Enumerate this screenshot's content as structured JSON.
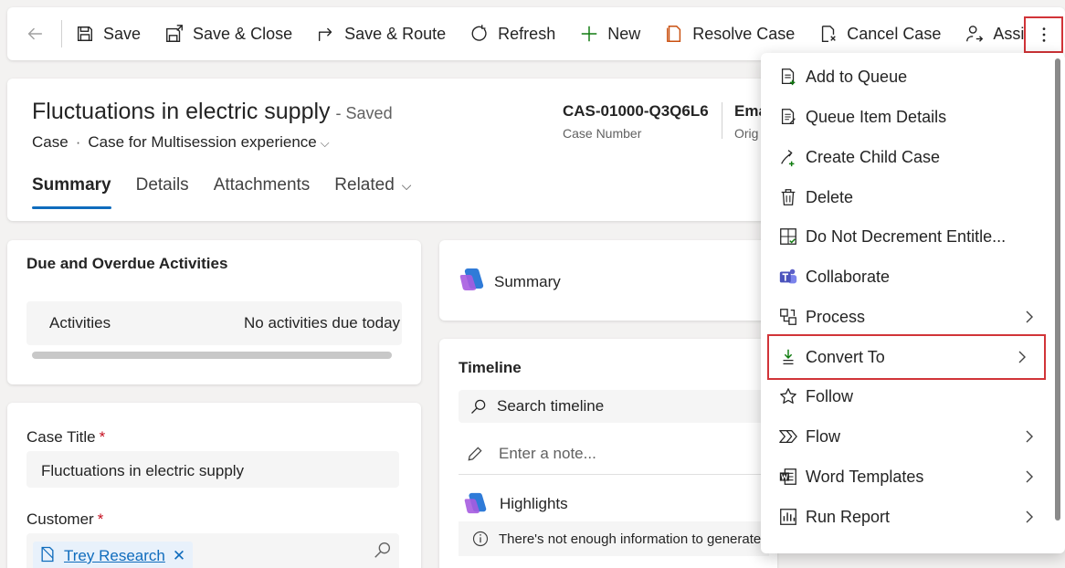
{
  "toolbar": {
    "save": "Save",
    "save_close": "Save & Close",
    "save_route": "Save & Route",
    "refresh": "Refresh",
    "new": "New",
    "resolve_case": "Resolve Case",
    "cancel_case": "Cancel Case",
    "assign": "Assign"
  },
  "record": {
    "title": "Fluctuations in electric supply",
    "status": "- Saved",
    "entity": "Case",
    "form": "Case for Multisession experience",
    "case_number": "CAS-01000-Q3Q6L6",
    "case_number_label": "Case Number",
    "origin_value": "Ema",
    "origin_label": "Orig"
  },
  "tabs": [
    "Summary",
    "Details",
    "Attachments",
    "Related"
  ],
  "due_card": {
    "title": "Due and Overdue Activities",
    "row_label": "Activities",
    "row_value": "No activities due today"
  },
  "form": {
    "case_title_label": "Case Title",
    "case_title_value": "Fluctuations in electric supply",
    "customer_label": "Customer",
    "customer_value": "Trey Research",
    "required_mark": "*"
  },
  "summary_card": {
    "label": "Summary"
  },
  "timeline": {
    "title": "Timeline",
    "search_placeholder": "Search timeline",
    "note_placeholder": "Enter a note...",
    "highlights": "Highlights",
    "info": "There's not enough information to generate"
  },
  "menu": {
    "items": [
      {
        "label": "Add to Queue",
        "icon": "add-to-queue-icon"
      },
      {
        "label": "Queue Item Details",
        "icon": "queue-details-icon"
      },
      {
        "label": "Create Child Case",
        "icon": "child-case-icon"
      },
      {
        "label": "Delete",
        "icon": "trash-icon"
      },
      {
        "label": "Do Not Decrement Entitle...",
        "icon": "entitlement-icon"
      },
      {
        "label": "Collaborate",
        "icon": "teams-icon"
      },
      {
        "label": "Process",
        "icon": "process-icon"
      },
      {
        "label": "Convert To",
        "icon": "convert-icon"
      },
      {
        "label": "Follow",
        "icon": "star-icon"
      },
      {
        "label": "Flow",
        "icon": "flow-icon"
      },
      {
        "label": "Word Templates",
        "icon": "word-icon"
      },
      {
        "label": "Run Report",
        "icon": "report-icon"
      }
    ]
  },
  "colors": {
    "accent": "#0f6cbd",
    "highlight_border": "#d13438",
    "required": "#c50f1f"
  }
}
